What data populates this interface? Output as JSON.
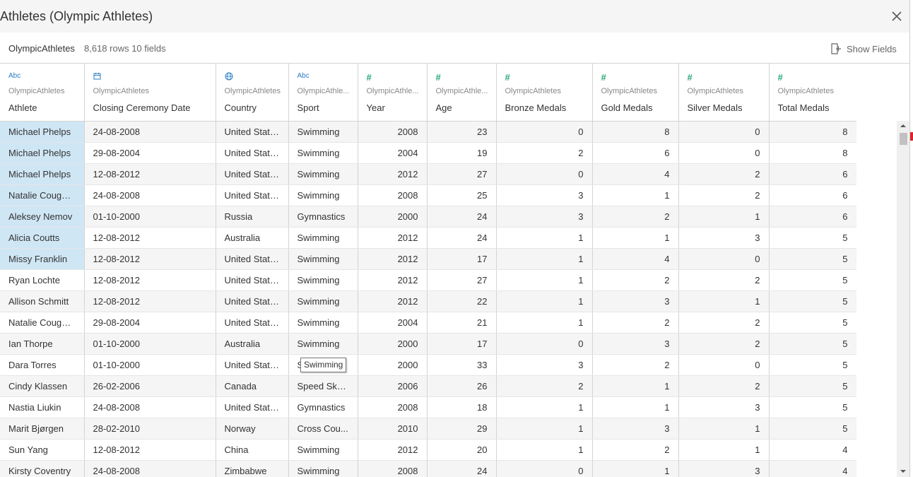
{
  "dialog": {
    "title": "Athletes (Olympic Athletes)"
  },
  "info": {
    "source_name": "OlympicAthletes",
    "meta": "8,618 rows  10 fields",
    "show_fields_label": "Show Fields"
  },
  "columns": [
    {
      "name": "Athlete",
      "source": "OlympicAthletes",
      "type_icon": "Abc",
      "type": "string",
      "align": "left"
    },
    {
      "name": "Closing Ceremony Date",
      "source": "OlympicAthletes",
      "type_icon": "calendar-icon",
      "type": "date",
      "align": "left"
    },
    {
      "name": "Country",
      "source": "OlympicAthletes",
      "type_icon": "globe-icon",
      "type": "geo",
      "align": "left"
    },
    {
      "name": "Sport",
      "source": "OlympicAthle...",
      "type_icon": "Abc",
      "type": "string",
      "align": "left"
    },
    {
      "name": "Year",
      "source": "OlympicAthle...",
      "type_icon": "#",
      "type": "number",
      "align": "right"
    },
    {
      "name": "Age",
      "source": "OlympicAthle...",
      "type_icon": "#",
      "type": "number",
      "align": "right"
    },
    {
      "name": "Bronze Medals",
      "source": "OlympicAthletes",
      "type_icon": "#",
      "type": "number",
      "align": "right"
    },
    {
      "name": "Gold Medals",
      "source": "OlympicAthletes",
      "type_icon": "#",
      "type": "number",
      "align": "right"
    },
    {
      "name": "Silver Medals",
      "source": "OlympicAthletes",
      "type_icon": "#",
      "type": "number",
      "align": "right"
    },
    {
      "name": "Total Medals",
      "source": "OlympicAthletes",
      "type_icon": "#",
      "type": "number",
      "align": "right"
    }
  ],
  "rows": [
    [
      "Michael Phelps",
      "24-08-2008",
      "United States",
      "Swimming",
      "2008",
      "23",
      "0",
      "8",
      "0",
      "8"
    ],
    [
      "Michael Phelps",
      "29-08-2004",
      "United States",
      "Swimming",
      "2004",
      "19",
      "2",
      "6",
      "0",
      "8"
    ],
    [
      "Michael Phelps",
      "12-08-2012",
      "United States",
      "Swimming",
      "2012",
      "27",
      "0",
      "4",
      "2",
      "6"
    ],
    [
      "Natalie Coughlin",
      "24-08-2008",
      "United States",
      "Swimming",
      "2008",
      "25",
      "3",
      "1",
      "2",
      "6"
    ],
    [
      "Aleksey Nemov",
      "01-10-2000",
      "Russia",
      "Gymnastics",
      "2000",
      "24",
      "3",
      "2",
      "1",
      "6"
    ],
    [
      "Alicia Coutts",
      "12-08-2012",
      "Australia",
      "Swimming",
      "2012",
      "24",
      "1",
      "1",
      "3",
      "5"
    ],
    [
      "Missy Franklin",
      "12-08-2012",
      "United States",
      "Swimming",
      "2012",
      "17",
      "1",
      "4",
      "0",
      "5"
    ],
    [
      "Ryan Lochte",
      "12-08-2012",
      "United States",
      "Swimming",
      "2012",
      "27",
      "1",
      "2",
      "2",
      "5"
    ],
    [
      "Allison Schmitt",
      "12-08-2012",
      "United States",
      "Swimming",
      "2012",
      "22",
      "1",
      "3",
      "1",
      "5"
    ],
    [
      "Natalie Coughlin",
      "29-08-2004",
      "United States",
      "Swimming",
      "2004",
      "21",
      "1",
      "2",
      "2",
      "5"
    ],
    [
      "Ian Thorpe",
      "01-10-2000",
      "Australia",
      "Swimming",
      "2000",
      "17",
      "0",
      "3",
      "2",
      "5"
    ],
    [
      "Dara Torres",
      "01-10-2000",
      "United States",
      "Swimming",
      "2000",
      "33",
      "3",
      "2",
      "0",
      "5"
    ],
    [
      "Cindy Klassen",
      "26-02-2006",
      "Canada",
      "Speed Ska...",
      "2006",
      "26",
      "2",
      "1",
      "2",
      "5"
    ],
    [
      "Nastia Liukin",
      "24-08-2008",
      "United States",
      "Gymnastics",
      "2008",
      "18",
      "1",
      "1",
      "3",
      "5"
    ],
    [
      "Marit Bjørgen",
      "28-02-2010",
      "Norway",
      "Cross Cou...",
      "2010",
      "29",
      "1",
      "3",
      "1",
      "5"
    ],
    [
      "Sun Yang",
      "12-08-2012",
      "China",
      "Swimming",
      "2012",
      "20",
      "1",
      "2",
      "1",
      "4"
    ],
    [
      "Kirsty Coventry",
      "24-08-2008",
      "Zimbabwe",
      "Swimming",
      "2008",
      "24",
      "0",
      "1",
      "3",
      "4"
    ]
  ],
  "highlighted_rows": [
    0,
    1,
    2,
    3,
    4,
    5,
    6
  ],
  "tooltip": {
    "text": "Swimming"
  },
  "colors": {
    "highlight": "#cfe6f5",
    "number_icon": "#2aa876",
    "string_icon": "#2a7dc4",
    "accent_edge": "#d9262b"
  }
}
